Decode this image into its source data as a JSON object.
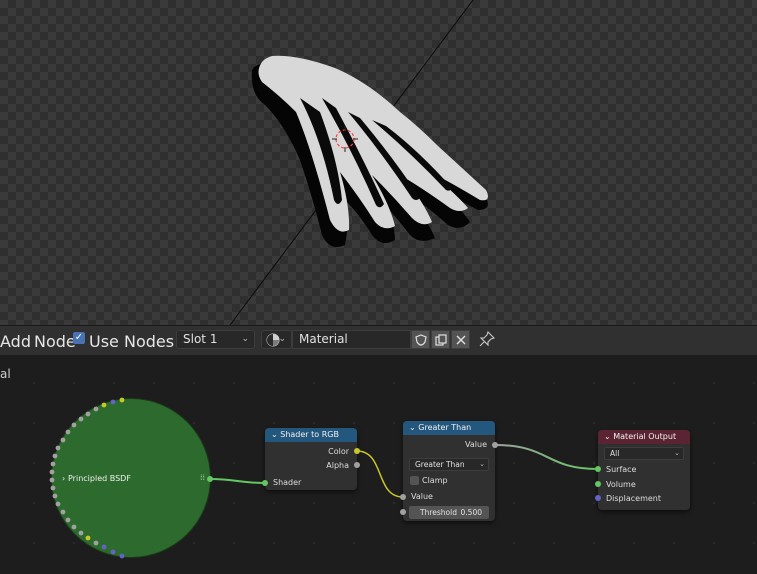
{
  "header": {
    "add_menu": "Add",
    "node_menu": "Node",
    "use_nodes_label": "Use Nodes",
    "use_nodes_checked": true,
    "slot": "Slot 1",
    "material_name": "Material"
  },
  "breadcrumb": "al",
  "nodes": {
    "principled": {
      "title": "Principled BSDF"
    },
    "shader_to_rgb": {
      "title": "Shader to RGB",
      "out_color": "Color",
      "out_alpha": "Alpha",
      "in_shader": "Shader"
    },
    "greater_than": {
      "title": "Greater Than",
      "out_value": "Value",
      "operation": "Greater Than",
      "clamp_label": "Clamp",
      "in_value": "Value",
      "threshold_label": "Threshold",
      "threshold_value": "0.500"
    },
    "material_output": {
      "title": "Material Output",
      "target": "All",
      "in_surface": "Surface",
      "in_volume": "Volume",
      "in_displacement": "Displacement"
    }
  },
  "colors": {
    "principled_body": "#2d6a2d",
    "shader_header": "#24577d",
    "converter_header": "#24577d",
    "output_header": "#5b2433",
    "checkbox_accent": "#4772b3"
  },
  "icons": [
    "shield-icon",
    "duplicate-icon",
    "close-icon",
    "pin-icon",
    "material-sphere-icon",
    "collapse-chevron-icon"
  ]
}
